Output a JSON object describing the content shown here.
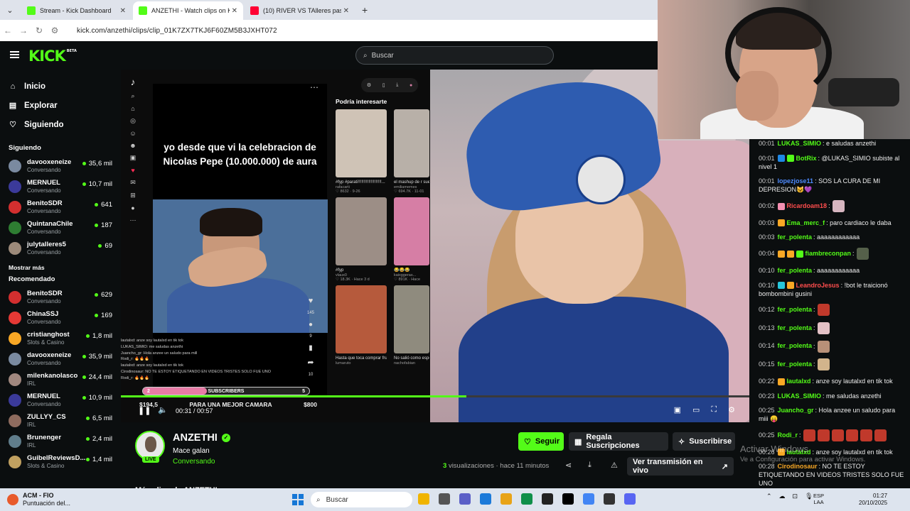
{
  "browser": {
    "tabs": [
      {
        "title": "Stream - Kick Dashboard",
        "fav_color": "#53fc18"
      },
      {
        "title": "ANZETHI - Watch clips on Kick",
        "fav_color": "#53fc18"
      },
      {
        "title": "(10) RIVER VS TAlleres paso a pa",
        "fav_color": "#ff0033"
      }
    ],
    "new_tab": "+",
    "url": "kick.com/anzethi/clips/clip_01K7ZX7TKJ6F60ZM5B3JXHT072"
  },
  "kick": {
    "logo": "KICK",
    "logo_beta": "BETA",
    "search_placeholder": "Buscar",
    "nav": [
      {
        "label": "Inicio",
        "icon": "⌂"
      },
      {
        "label": "Explorar",
        "icon": "▤"
      },
      {
        "label": "Siguiendo",
        "icon": "♡"
      }
    ],
    "following_title": "Siguiendo",
    "following": [
      {
        "name": "davooxeneize",
        "category": "Conversando",
        "viewers": "35,6 mil",
        "color": "#7a8aa0"
      },
      {
        "name": "MERNUEL",
        "category": "Conversando",
        "viewers": "10,7 mil",
        "color": "#3b3a9a"
      },
      {
        "name": "BenitoSDR",
        "category": "Conversando",
        "viewers": "641",
        "color": "#d32f2f"
      },
      {
        "name": "QuintanaChile",
        "category": "Conversando",
        "viewers": "187",
        "color": "#2e7d32"
      },
      {
        "name": "julytalleres5",
        "category": "Conversando",
        "viewers": "69",
        "color": "#9c8a7a"
      }
    ],
    "show_more": "Mostrar más",
    "recommended_title": "Recomendado",
    "recommended": [
      {
        "name": "BenitoSDR",
        "category": "Conversando",
        "viewers": "629",
        "color": "#d32f2f"
      },
      {
        "name": "ChinaSSJ",
        "category": "Conversando",
        "viewers": "169",
        "color": "#e53935"
      },
      {
        "name": "cristianghost",
        "category": "Slots & Casino",
        "viewers": "1,8 mil",
        "color": "#f9a825"
      },
      {
        "name": "davooxeneize",
        "category": "Conversando",
        "viewers": "35,9 mil",
        "color": "#7a8aa0"
      },
      {
        "name": "milenkanolasco",
        "category": "IRL",
        "viewers": "24,4 mil",
        "color": "#a1887f"
      },
      {
        "name": "MERNUEL",
        "category": "Conversando",
        "viewers": "10,9 mil",
        "color": "#3b3a9a"
      },
      {
        "name": "ZULLYY_CS",
        "category": "IRL",
        "viewers": "6,5 mil",
        "color": "#8e6b5e"
      },
      {
        "name": "Brunenger",
        "category": "IRL",
        "viewers": "2,4 mil",
        "color": "#607d8b"
      },
      {
        "name": "GuibelReviewsD...",
        "category": "Slots & Casino",
        "viewers": "1,4 mil",
        "color": "#c0a060"
      }
    ]
  },
  "tiktok": {
    "caption": "yo desde que vi la celebracion de Nicolas Pepe (10.000.000) de aura",
    "recs_title": "Podría interesarte",
    "likes": "145",
    "comments": "9",
    "shares": "10",
    "thumbs": [
      {
        "label": "#fyp #parati!!!!!!!!!!!!!!!!!!!!...",
        "sub": "rafacarti",
        "stats": "♡ 8632 · 9-26",
        "color": "#cfc3b6"
      },
      {
        "label": "el mashup de r sueños [",
        "sub": "emiliamemes",
        "stats": "♡ 694.7K · 11-01",
        "color": "#b8b0a8"
      },
      {
        "label": "#fyp",
        "sub": "vlaux0",
        "stats": "♡ 18.3K · Hace 3 d",
        "color": "#9c8e86"
      },
      {
        "label": "😂😂😂",
        "sub": "kaixggeras...",
        "stats": "♡ 891K · Hace",
        "color": "#d67ea5"
      },
      {
        "label": "Hasta que toca comprar frutas 😅 ...",
        "sub": "lumaruto",
        "stats": "",
        "color": "#b65a3c"
      },
      {
        "label": "No salió como esperábamos ...",
        "sub": "nachofabian",
        "stats": "",
        "color": "#8f8b7e"
      }
    ],
    "chat_overlay": [
      "lautalxd: anze soy lautalxd en tik tok",
      "LUKAS_SIMIO: me saludas anzethi",
      "Juancho_gr: Hola anzee un saludo para mill",
      "Rodi_r: 🔥🔥🔥",
      "lautalxd: anze soy lautalxd en tik tok",
      "Cirodinosaur: NO TE ESTOY ETIQUETANDO EN VIDEOS TRISTES SOLO FUE UNO",
      "Rodi_r: 🔥🔥🔥"
    ]
  },
  "player": {
    "subs_label": "SUBSCRIBERS",
    "subs_left": "2",
    "subs_right": "5",
    "goal_left": "$194,5",
    "goal_text": "PARA UNA MEJOR CAMARA",
    "goal_right": "$800",
    "time": "00:31 / 00:57",
    "progress": 0.55
  },
  "channel": {
    "name": "ANZETHI",
    "title": "Mace galan",
    "category": "Conversando",
    "live": "LIVE",
    "follow": "Seguir",
    "gift": "Regala Suscripciones",
    "subscribe": "Suscribirse",
    "views_num": "3",
    "views_label": "visualizaciones",
    "ago": "hace 11 minutos",
    "live_link": "Ver transmisión en vivo",
    "more_clips": "Más clips de ANZETHI"
  },
  "chat": [
    {
      "ts": "00:01",
      "user": "LUKAS_SIMIO",
      "color": "#53fc18",
      "text": ": e saludas anzethi",
      "emotes": []
    },
    {
      "ts": "00:01",
      "user": "BotRix",
      "color": "#53fc18",
      "text": ": @LUKAS_SIMIO subiste al nivel 1",
      "emotes": [],
      "badges": [
        "#1e88e5",
        "#53fc18"
      ]
    },
    {
      "ts": "00:01",
      "user": "lopezjose11",
      "color": "#4f8cff",
      "text": ": SOS LA CURA DE MI DEPRESION😺💜",
      "emotes": []
    },
    {
      "ts": "00:02",
      "user": "Ricardoam18",
      "color": "#ff4d4d",
      "text": ":",
      "emotes": [
        "#d7b6c0"
      ],
      "badges": [
        "#f48fb1"
      ]
    },
    {
      "ts": "00:03",
      "user": "Ema_merc_f",
      "color": "#53fc18",
      "text": ": paro cardiaco le daba",
      "emotes": [],
      "badges": [
        "#f9a825"
      ]
    },
    {
      "ts": "00:03",
      "user": "fer_polenta",
      "color": "#53fc18",
      "text": ": aaaaaaaaaaaa",
      "emotes": []
    },
    {
      "ts": "00:04",
      "user": "fiambreconpan",
      "color": "#53fc18",
      "text": ":",
      "emotes": [
        "#55604a"
      ],
      "badges": [
        "#f9a825",
        "#f9a825",
        "#53fc18"
      ]
    },
    {
      "ts": "00:10",
      "user": "fer_polenta",
      "color": "#53fc18",
      "text": ": aaaaaaaaaaaa",
      "emotes": []
    },
    {
      "ts": "00:10",
      "user": "LeandroJesus",
      "color": "#ff4d4d",
      "text": ": !bot le traicionó bombombini gusini",
      "emotes": [],
      "badges": [
        "#26c6da",
        "#f9a825"
      ]
    },
    {
      "ts": "00:12",
      "user": "fer_polenta",
      "color": "#53fc18",
      "text": ":",
      "emotes": [
        "#c0392b"
      ]
    },
    {
      "ts": "00:13",
      "user": "fer_polenta",
      "color": "#53fc18",
      "text": ":",
      "emotes": [
        "#e3c1c6"
      ]
    },
    {
      "ts": "00:14",
      "user": "fer_polenta",
      "color": "#53fc18",
      "text": ":",
      "emotes": [
        "#b89078"
      ]
    },
    {
      "ts": "00:15",
      "user": "fer_polenta",
      "color": "#53fc18",
      "text": ":",
      "emotes": [
        "#d2b48c"
      ]
    },
    {
      "ts": "00:22",
      "user": "lautalxd",
      "color": "#53fc18",
      "text": ": anze soy lautalxd en tik tok",
      "emotes": [],
      "badges": [
        "#f9a825"
      ]
    },
    {
      "ts": "00:23",
      "user": "LUKAS_SIMIO",
      "color": "#53fc18",
      "text": ": me saludas anzethi",
      "emotes": []
    },
    {
      "ts": "00:25",
      "user": "Juancho_gr",
      "color": "#53fc18",
      "text": ": Hola anzee un saludo para miii 😛",
      "emotes": []
    },
    {
      "ts": "00:25",
      "user": "Rodi_r",
      "color": "#53fc18",
      "text": ":",
      "emotes": [
        "#c0392b",
        "#c0392b",
        "#c0392b",
        "#c0392b",
        "#c0392b",
        "#c0392b"
      ]
    },
    {
      "ts": "00:26",
      "user": "lautalxd",
      "color": "#53fc18",
      "text": ": anze soy lautalxd en tik tok",
      "emotes": [],
      "badges": [
        "#f9a825"
      ]
    },
    {
      "ts": "00:28",
      "user": "Cirodinosaur",
      "color": "#f9a825",
      "text": ": NO TE ESTOY ETIQUETANDO EN VIDEOS TRISTES SOLO FUE UNO",
      "emotes": []
    },
    {
      "ts": "00:29",
      "user": "Rodi_r",
      "color": "#53fc18",
      "text": ":",
      "emotes": [
        "#c0392b",
        "#d67ea5",
        "#6a8f3a",
        "#d67ea5"
      ]
    }
  ],
  "watermark": {
    "line1": "Activar Windows",
    "line2": "Ve a Configuración para activar Windows."
  },
  "taskbar": {
    "weather_title": "ACM - FIO",
    "weather_sub": "Puntuación del...",
    "search": "Buscar",
    "lang1": "ESP",
    "lang2": "LAA",
    "time": "01:27",
    "date": "20/10/2025",
    "apps": [
      "#f0b400",
      "#555555",
      "#5b5fc7",
      "#1c7ad9",
      "#e8a317",
      "#0f8f4a",
      "#222222",
      "#000000",
      "#4285f4",
      "#333333",
      "#5865f2"
    ]
  }
}
